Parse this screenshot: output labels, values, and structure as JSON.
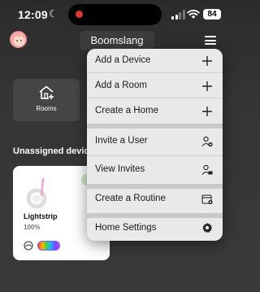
{
  "status": {
    "time": "12:09",
    "battery": "84"
  },
  "header": {
    "home_name": "Boomslang"
  },
  "rooms_tile": {
    "label": "Rooms"
  },
  "section": {
    "title": "Unassigned devices"
  },
  "device": {
    "name": "Lightstrip",
    "level": "100%",
    "on": true
  },
  "menu": {
    "items": [
      {
        "label": "Add a Device",
        "icon": "plus-icon"
      },
      {
        "label": "Add a Room",
        "icon": "plus-icon"
      },
      {
        "label": "Create a Home",
        "icon": "plus-icon"
      },
      {
        "label": "Invite a User",
        "icon": "user-add-icon"
      },
      {
        "label": "View Invites",
        "icon": "user-invites-icon"
      },
      {
        "label": "Create a Routine",
        "icon": "routine-calendar-icon"
      },
      {
        "label": "Home Settings",
        "icon": "gear-icon"
      }
    ]
  },
  "colors": {
    "background": "#333333",
    "menu_bg": "#e9e9e9",
    "recording_dot": "#e0362c"
  }
}
